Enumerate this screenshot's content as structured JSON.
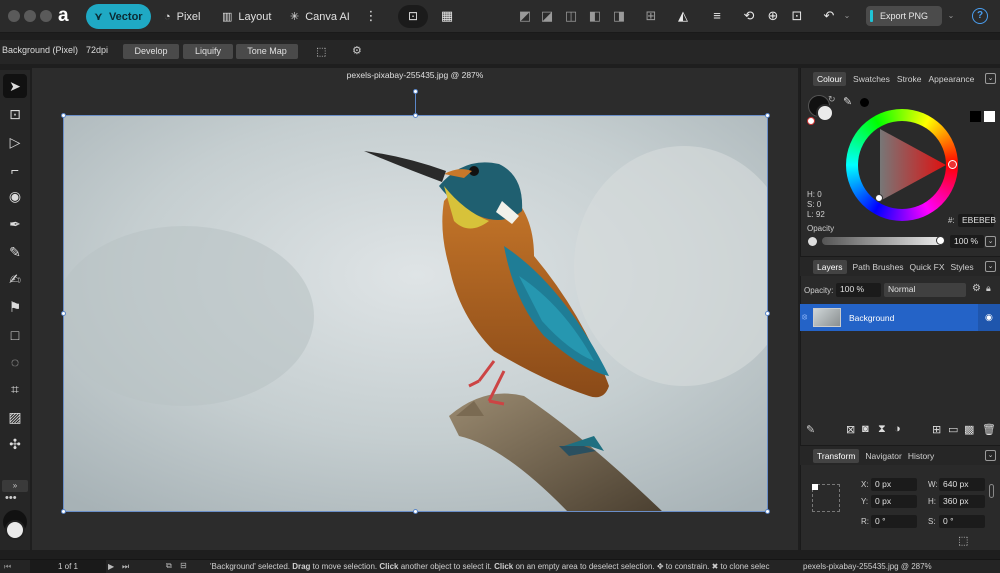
{
  "toolbar": {
    "personas": [
      {
        "label": "Vector",
        "icon": "vector-persona-icon",
        "active": true
      },
      {
        "label": "Pixel",
        "icon": "pixel-persona-icon",
        "active": false
      },
      {
        "label": "Layout",
        "icon": "layout-persona-icon",
        "active": false
      },
      {
        "label": "Canva AI",
        "icon": "sparkle-icon",
        "active": false
      }
    ],
    "export_label": "Export PNG"
  },
  "context": {
    "layer_type": "Background (Pixel)",
    "dpi": "72dpi",
    "buttons": [
      "Develop",
      "Liquify",
      "Tone Map"
    ]
  },
  "document": {
    "title": "pexels-pixabay-255435.jpg @ 287%"
  },
  "colour_panel": {
    "tabs": [
      "Colour",
      "Swatches",
      "Stroke",
      "Appearance"
    ],
    "hsl": {
      "h": "H: 0",
      "s": "S: 0",
      "l": "L: 92"
    },
    "hex_label": "#:",
    "hex_value": "EBEBEB",
    "opacity_label": "Opacity",
    "opacity_value": "100 %"
  },
  "layers_panel": {
    "tabs": [
      "Layers",
      "Path Brushes",
      "Quick FX",
      "Styles"
    ],
    "opacity_label": "Opacity:",
    "opacity_value": "100 %",
    "blend_mode": "Normal",
    "layers": [
      {
        "name": "Background",
        "selected": true
      }
    ]
  },
  "transform_panel": {
    "tabs": [
      "Transform",
      "Navigator",
      "History"
    ],
    "x_label": "X:",
    "x_value": "0 px",
    "y_label": "Y:",
    "y_value": "0 px",
    "w_label": "W:",
    "w_value": "640 px",
    "h_label": "H:",
    "h_value": "360 px",
    "r_label": "R:",
    "r_value": "0 °",
    "s_label": "S:",
    "s_value": "0 °"
  },
  "status": {
    "page": "1 of 1",
    "message_parts": [
      {
        "text": "'Background' selected. ",
        "bold": false
      },
      {
        "text": "Drag",
        "bold": true
      },
      {
        "text": " to move selection. ",
        "bold": false
      },
      {
        "text": "Click",
        "bold": true
      },
      {
        "text": " another object to select it. ",
        "bold": false
      },
      {
        "text": "Click",
        "bold": true
      },
      {
        "text": " on an empty area to deselect selection. ✥ to constrain. ✖ to clone selec",
        "bold": false
      }
    ],
    "right_text": "pexels-pixabay-255435.jpg @ 287%"
  },
  "colors": {
    "accent": "#1fa9c4",
    "selection": "#2463c7",
    "panel": "#2a2a2a"
  }
}
